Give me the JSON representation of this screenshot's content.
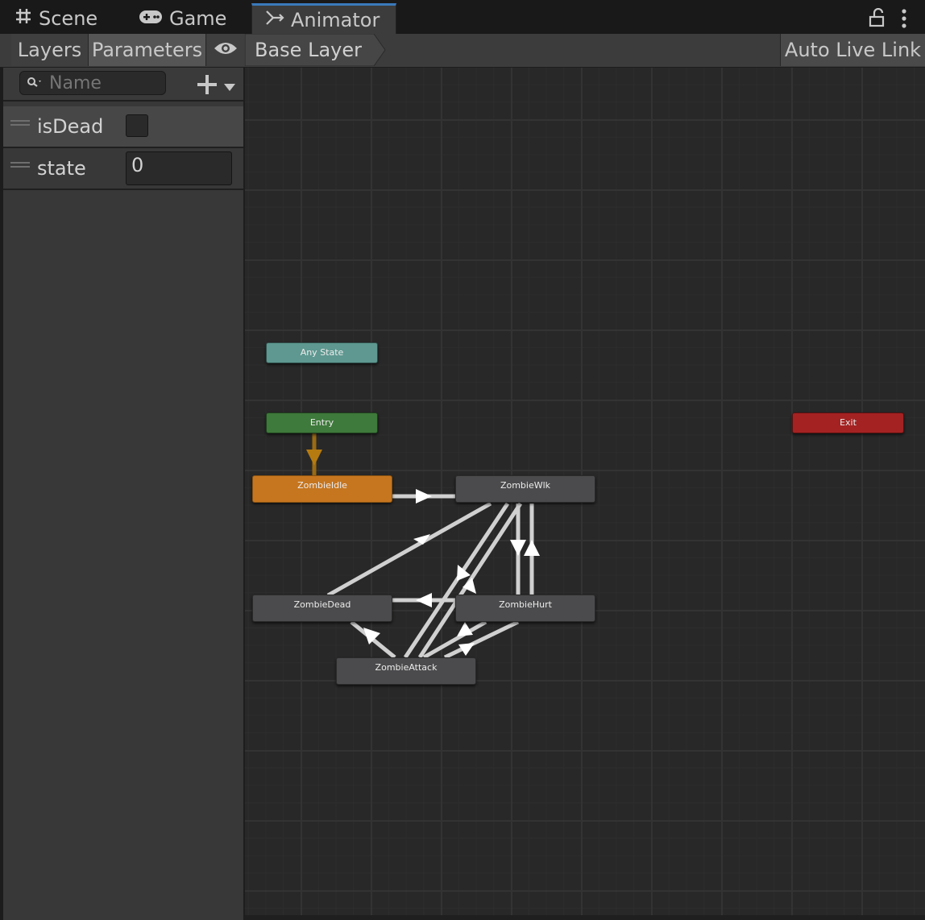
{
  "tabs": {
    "scene": "Scene",
    "game": "Game",
    "animator": "Animator"
  },
  "toolbar": {
    "layers": "Layers",
    "parameters": "Parameters",
    "breadcrumb": "Base Layer",
    "auto_live_link": "Auto Live Link"
  },
  "search": {
    "placeholder": "Name"
  },
  "parameters": [
    {
      "name": "isDead",
      "type": "bool",
      "value": false
    },
    {
      "name": "state",
      "type": "int",
      "value": "0"
    }
  ],
  "nodes": {
    "any_state": "Any State",
    "entry": "Entry",
    "exit": "Exit",
    "idle": "ZombieIdle",
    "walk": "ZombieWlk",
    "dead": "ZombieDead",
    "hurt": "ZombieHurt",
    "attack": "ZombieAttack"
  },
  "colors": {
    "tab_accent": "#3a79bb",
    "any_state": "#5e9890",
    "entry": "#3e7a3b",
    "exit": "#a42222",
    "default_state": "#c6761f",
    "state": "#4b4b4d",
    "transition": "#d0d0d0",
    "default_transition": "#9a6a14"
  },
  "icons": {
    "scene": "grid-icon",
    "game": "gamepad-icon",
    "animator": "animator-icon",
    "lock": "lock-icon",
    "menu": "kebab-menu-icon",
    "eye": "eye-icon",
    "search": "search-icon",
    "add": "plus-icon",
    "dropdown": "chevron-down-icon"
  }
}
